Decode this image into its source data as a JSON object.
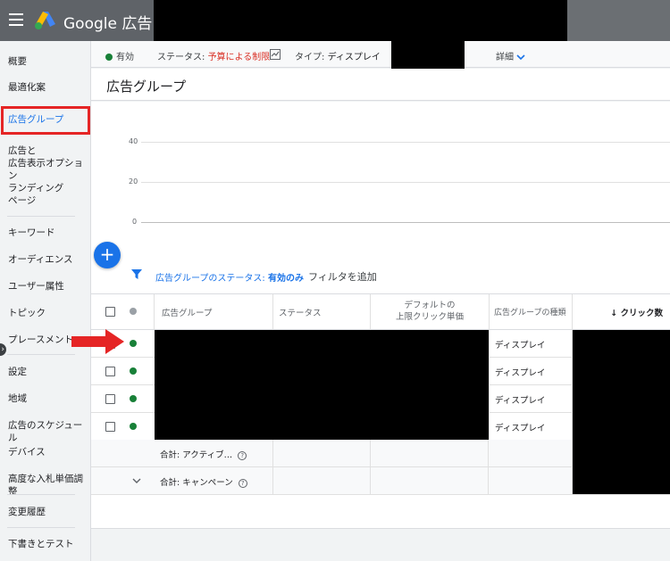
{
  "header": {
    "brand": "Google 広告"
  },
  "sidebar": {
    "items": [
      {
        "label": "概要"
      },
      {
        "label": "最適化案"
      },
      {
        "label": "広告グループ"
      },
      {
        "label": "広告と\n広告表示オプション"
      },
      {
        "label": "ランディング\nページ"
      },
      {
        "label": "キーワード"
      },
      {
        "label": "オーディエンス"
      },
      {
        "label": "ユーザー属性"
      },
      {
        "label": "トピック"
      },
      {
        "label": "プレースメント"
      },
      {
        "label": "設定"
      },
      {
        "label": "地域"
      },
      {
        "label": "広告のスケジュール"
      },
      {
        "label": "デバイス"
      },
      {
        "label": "高度な入札単価調整"
      },
      {
        "label": "変更履歴"
      },
      {
        "label": "下書きとテスト"
      }
    ]
  },
  "statusbar": {
    "enabled": "有効",
    "status_label": "ステータス:",
    "status_value": "予算による制限",
    "type_label": "タイプ:",
    "type_value": "ディスプレイ",
    "detail": "詳細"
  },
  "page": {
    "title": "広告グループ"
  },
  "chart": {
    "ticks": [
      "40",
      "20",
      "0"
    ]
  },
  "filter": {
    "prefix": "広告グループのステータス:",
    "value": "有効のみ",
    "add": "フィルタを追加"
  },
  "table": {
    "headers": {
      "group": "広告グループ",
      "status": "ステータス",
      "cpc": "デフォルトの\n上限クリック単価",
      "type": "広告グループの種類",
      "clicks": "クリック数"
    },
    "rows": [
      {
        "type": "ディスプレイ"
      },
      {
        "type": "ディスプレイ"
      },
      {
        "type": "ディスプレイ"
      },
      {
        "type": "ディスプレイ"
      }
    ],
    "totals": {
      "active": "合計: アクティブ…",
      "campaign": "合計: キャンペーン"
    }
  },
  "colors": {
    "accent": "#1a73e8",
    "enabled": "#188038",
    "warning": "#d93025",
    "highlight": "#e52525"
  }
}
